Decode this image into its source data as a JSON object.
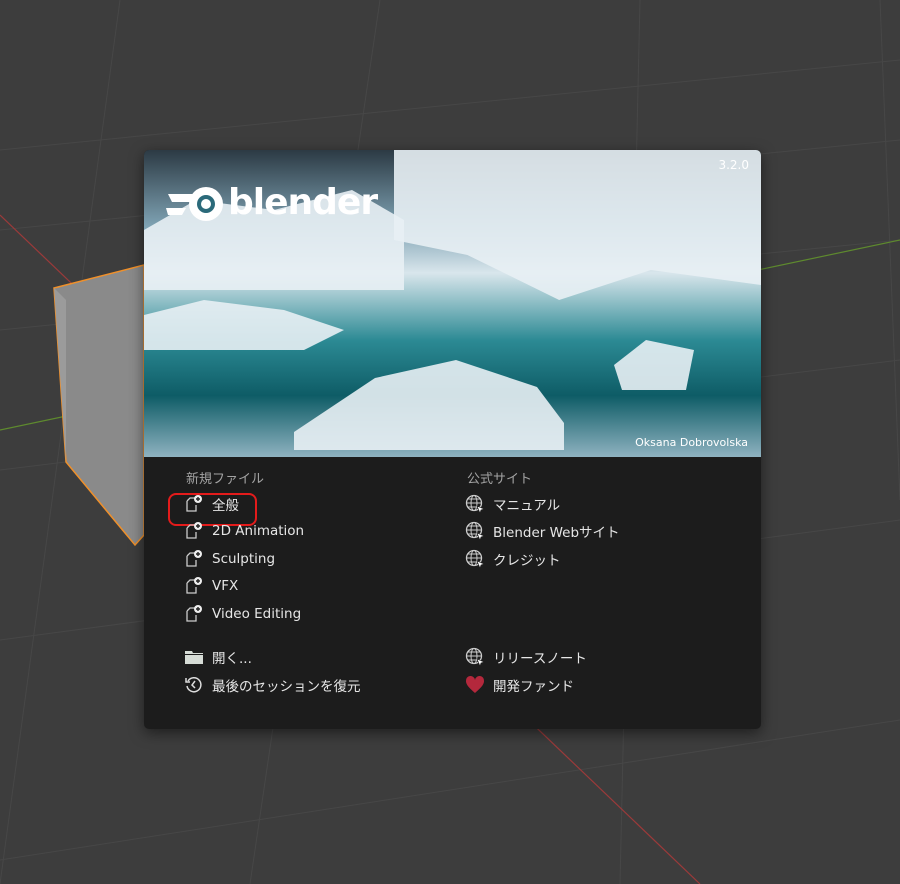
{
  "splash": {
    "version": "3.2.0",
    "brand": "blender",
    "artist_credit": "Oksana Dobrovolska"
  },
  "new_file": {
    "header": "新規ファイル",
    "items": [
      {
        "label": "全般"
      },
      {
        "label": "2D Animation"
      },
      {
        "label": "Sculpting"
      },
      {
        "label": "VFX"
      },
      {
        "label": "Video Editing"
      }
    ]
  },
  "file_actions": [
    {
      "label": "開く...",
      "icon": "folder-icon"
    },
    {
      "label": "最後のセッションを復元",
      "icon": "recover-icon"
    }
  ],
  "official": {
    "header": "公式サイト",
    "items": [
      {
        "label": "マニュアル"
      },
      {
        "label": "Blender Webサイト"
      },
      {
        "label": "クレジット"
      }
    ]
  },
  "links": [
    {
      "label": "リリースノート",
      "icon": "globe-icon"
    },
    {
      "label": "開発ファンド",
      "icon": "heart-icon",
      "color": "#b4283c"
    }
  ],
  "colors": {
    "highlight": "#e31b1b",
    "selection": "#f0902a"
  }
}
